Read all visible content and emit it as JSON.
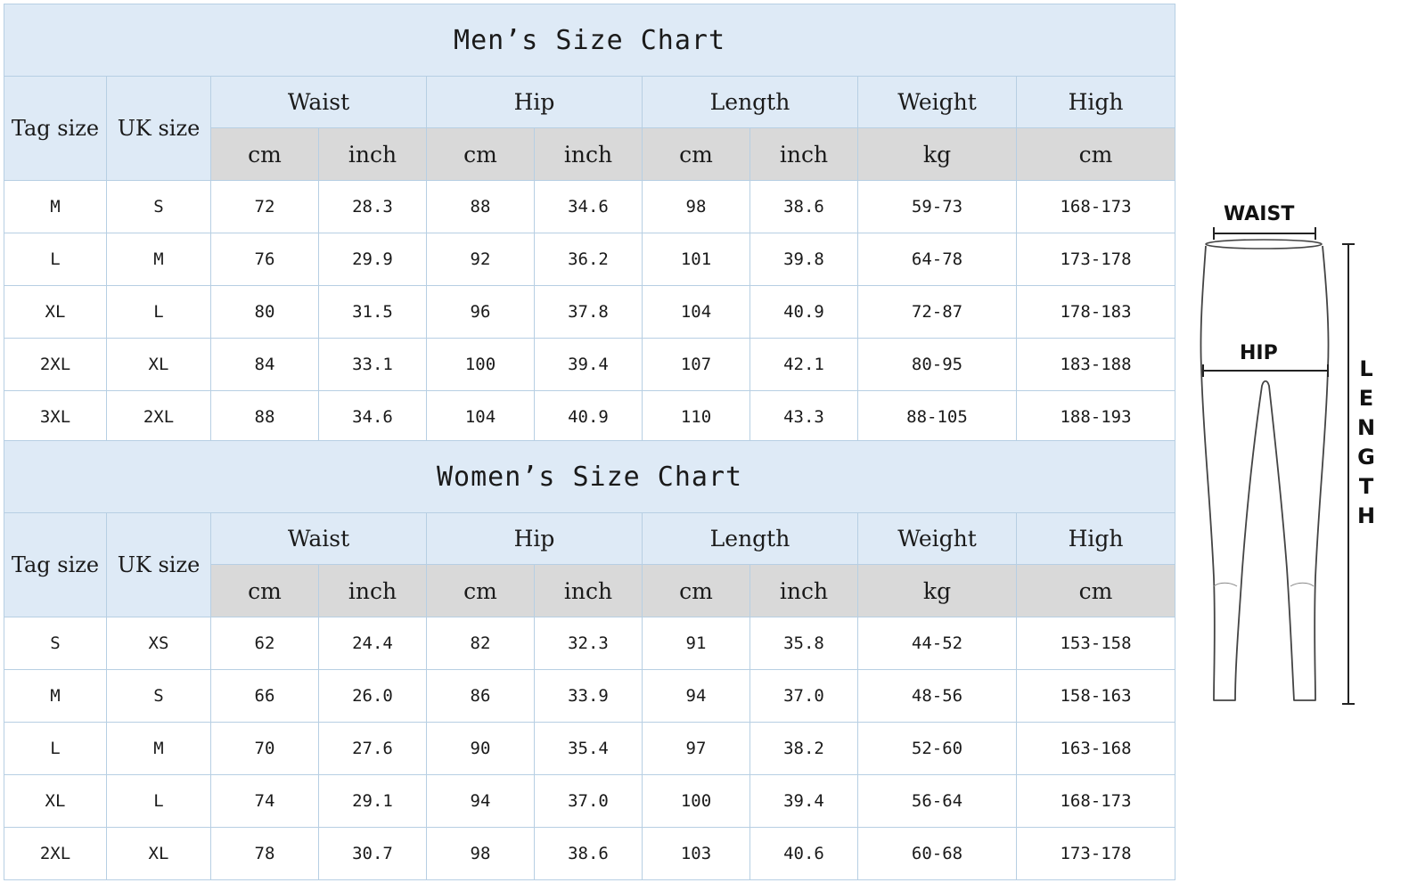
{
  "men": {
    "title": "Men’s Size Chart",
    "tag_header": "Tag size",
    "uk_header": "UK size",
    "groups": [
      "Waist",
      "Hip",
      "Length",
      "Weight",
      "High"
    ],
    "units": [
      "cm",
      "inch",
      "cm",
      "inch",
      "cm",
      "inch",
      "kg",
      "cm"
    ],
    "rows": [
      [
        "M",
        "S",
        "72",
        "28.3",
        "88",
        "34.6",
        "98",
        "38.6",
        "59-73",
        "168-173"
      ],
      [
        "L",
        "M",
        "76",
        "29.9",
        "92",
        "36.2",
        "101",
        "39.8",
        "64-78",
        "173-178"
      ],
      [
        "XL",
        "L",
        "80",
        "31.5",
        "96",
        "37.8",
        "104",
        "40.9",
        "72-87",
        "178-183"
      ],
      [
        "2XL",
        "XL",
        "84",
        "33.1",
        "100",
        "39.4",
        "107",
        "42.1",
        "80-95",
        "183-188"
      ],
      [
        "3XL",
        "2XL",
        "88",
        "34.6",
        "104",
        "40.9",
        "110",
        "43.3",
        "88-105",
        "188-193"
      ]
    ]
  },
  "women": {
    "title": "Women’s Size Chart",
    "tag_header": "Tag size",
    "uk_header": "UK size",
    "groups": [
      "Waist",
      "Hip",
      "Length",
      "Weight",
      "High"
    ],
    "units": [
      "cm",
      "inch",
      "cm",
      "inch",
      "cm",
      "inch",
      "kg",
      "cm"
    ],
    "rows": [
      [
        "S",
        "XS",
        "62",
        "24.4",
        "82",
        "32.3",
        "91",
        "35.8",
        "44-52",
        "153-158"
      ],
      [
        "M",
        "S",
        "66",
        "26.0",
        "86",
        "33.9",
        "94",
        "37.0",
        "48-56",
        "158-163"
      ],
      [
        "L",
        "M",
        "70",
        "27.6",
        "90",
        "35.4",
        "97",
        "38.2",
        "52-60",
        "163-168"
      ],
      [
        "XL",
        "L",
        "74",
        "29.1",
        "94",
        "37.0",
        "100",
        "39.4",
        "56-64",
        "168-173"
      ],
      [
        "2XL",
        "XL",
        "78",
        "30.7",
        "98",
        "38.6",
        "103",
        "40.6",
        "60-68",
        "173-178"
      ]
    ]
  },
  "diagram": {
    "waist_label": "WAIST",
    "hip_label": "HIP",
    "length_label": "LENGTH"
  },
  "colors": {
    "header_blue": "#deeaf6",
    "unit_gray": "#d9d9d9",
    "border": "#b7cfe3"
  }
}
